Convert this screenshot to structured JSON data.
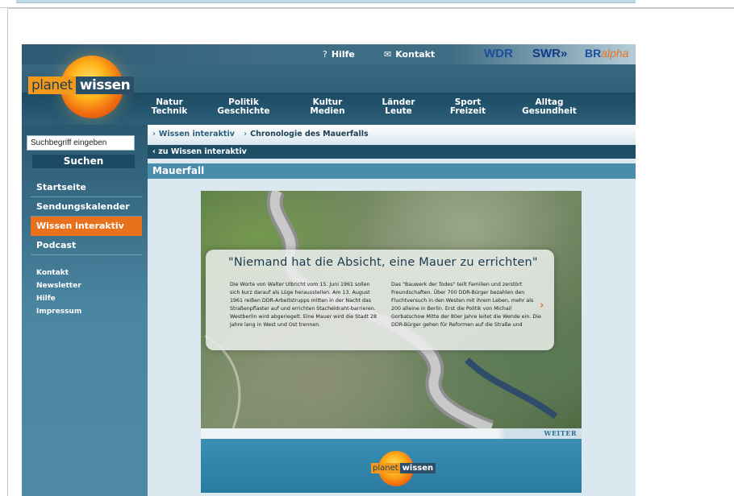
{
  "header": {
    "logo_part1": "planet",
    "logo_part2": "wissen",
    "util_links": [
      {
        "icon": "?",
        "label": "Hilfe"
      },
      {
        "icon": "✉",
        "label": "Kontakt"
      }
    ],
    "partners": [
      "WDR",
      "SWR»",
      "BR",
      "alpha"
    ],
    "nav": [
      {
        "line1": "Natur",
        "line2": "Technik"
      },
      {
        "line1": "Politik",
        "line2": "Geschichte"
      },
      {
        "line1": "Kultur",
        "line2": "Medien"
      },
      {
        "line1": "Länder",
        "line2": "Leute"
      },
      {
        "line1": "Sport",
        "line2": "Freizeit"
      },
      {
        "line1": "Alltag",
        "line2": "Gesundheit"
      }
    ]
  },
  "sidebar": {
    "search_value": "Suchbegriff eingeben",
    "search_button": "Suchen",
    "menu": [
      "Startseite",
      "Sendungskalender",
      "Wissen interaktiv",
      "Podcast"
    ],
    "active_index": 2,
    "submenu": [
      "Kontakt",
      "Newsletter",
      "Hilfe",
      "Impressum"
    ]
  },
  "content": {
    "breadcrumb": [
      "Wissen interaktiv",
      "Chronologie des Mauerfalls"
    ],
    "back_link": "zu Wissen interaktiv",
    "title": "Mauerfall",
    "quote": "\"Niemand hat die Absicht, eine Mauer zu errichten\"",
    "col_left": "Die Worte von Walter Ulbricht vom 15. Juni 1961 sollen sich kurz darauf als Lüge herausstellen. Am 13. August 1961 reißen DDR-Arbeitstrupps mitten in der Nacht das Straßenpflaster auf und errichten Stacheldraht-barrieren. Westberlin wird abgeriegelt. Eine Mauer wird die Stadt 28 Jahre lang in West und Ost trennen.",
    "col_right": "Das \"Bauwerk der Todes\" teilt Familien und zerstört Freundschaften. Über 700 DDR-Bürger bezahlen den Fluchtversuch in den Westen mit ihrem Leben, mehr als 200 alleine in Berlin. Erst die Politik von Michail Gorbatschow Mitte der 80er Jahre leitet die Wende ein. Die DDR-Bürger gehen für Reformen auf die Straße und",
    "next_arrow": "›",
    "weiter": "WEITER",
    "bottom_logo_part1": "planet",
    "bottom_logo_part2": "wissen"
  },
  "colors": {
    "accent_orange": "#e8711e",
    "dark_blue": "#1e4d66",
    "mid_blue": "#4a8cab"
  }
}
